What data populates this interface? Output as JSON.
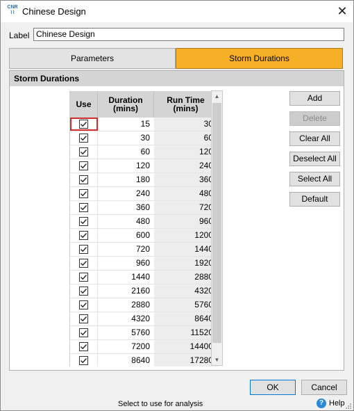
{
  "window": {
    "title": "Chinese Design",
    "app_icon_text": "CNR"
  },
  "label_field": {
    "label": "Label",
    "value": "Chinese Design"
  },
  "tabs": [
    {
      "label": "Parameters",
      "active": false
    },
    {
      "label": "Storm Durations",
      "active": true
    }
  ],
  "group": {
    "title": "Storm Durations"
  },
  "grid": {
    "columns": {
      "use": "Use",
      "duration": "Duration\n(mins)",
      "run_time": "Run Time\n(mins)"
    },
    "rows": [
      {
        "use": true,
        "duration": "15",
        "run_time": "30"
      },
      {
        "use": true,
        "duration": "30",
        "run_time": "60"
      },
      {
        "use": true,
        "duration": "60",
        "run_time": "120"
      },
      {
        "use": true,
        "duration": "120",
        "run_time": "240"
      },
      {
        "use": true,
        "duration": "180",
        "run_time": "360"
      },
      {
        "use": true,
        "duration": "240",
        "run_time": "480"
      },
      {
        "use": true,
        "duration": "360",
        "run_time": "720"
      },
      {
        "use": true,
        "duration": "480",
        "run_time": "960"
      },
      {
        "use": true,
        "duration": "600",
        "run_time": "1200"
      },
      {
        "use": true,
        "duration": "720",
        "run_time": "1440"
      },
      {
        "use": true,
        "duration": "960",
        "run_time": "1920"
      },
      {
        "use": true,
        "duration": "1440",
        "run_time": "2880"
      },
      {
        "use": true,
        "duration": "2160",
        "run_time": "4320"
      },
      {
        "use": true,
        "duration": "2880",
        "run_time": "5760"
      },
      {
        "use": true,
        "duration": "4320",
        "run_time": "8640"
      },
      {
        "use": true,
        "duration": "5760",
        "run_time": "11520"
      },
      {
        "use": true,
        "duration": "7200",
        "run_time": "14400"
      },
      {
        "use": true,
        "duration": "8640",
        "run_time": "17280"
      }
    ]
  },
  "side_buttons": {
    "add": "Add",
    "delete": "Delete",
    "clear_all": "Clear All",
    "deselect_all": "Deselect All",
    "select_all": "Select All",
    "default": "Default"
  },
  "footer": {
    "ok": "OK",
    "cancel": "Cancel",
    "status": "Select to use for analysis",
    "help": "Help"
  },
  "colors": {
    "active_tab": "#f5b027",
    "selection_outline": "#d42b2b",
    "help_icon": "#2a8ad8"
  }
}
